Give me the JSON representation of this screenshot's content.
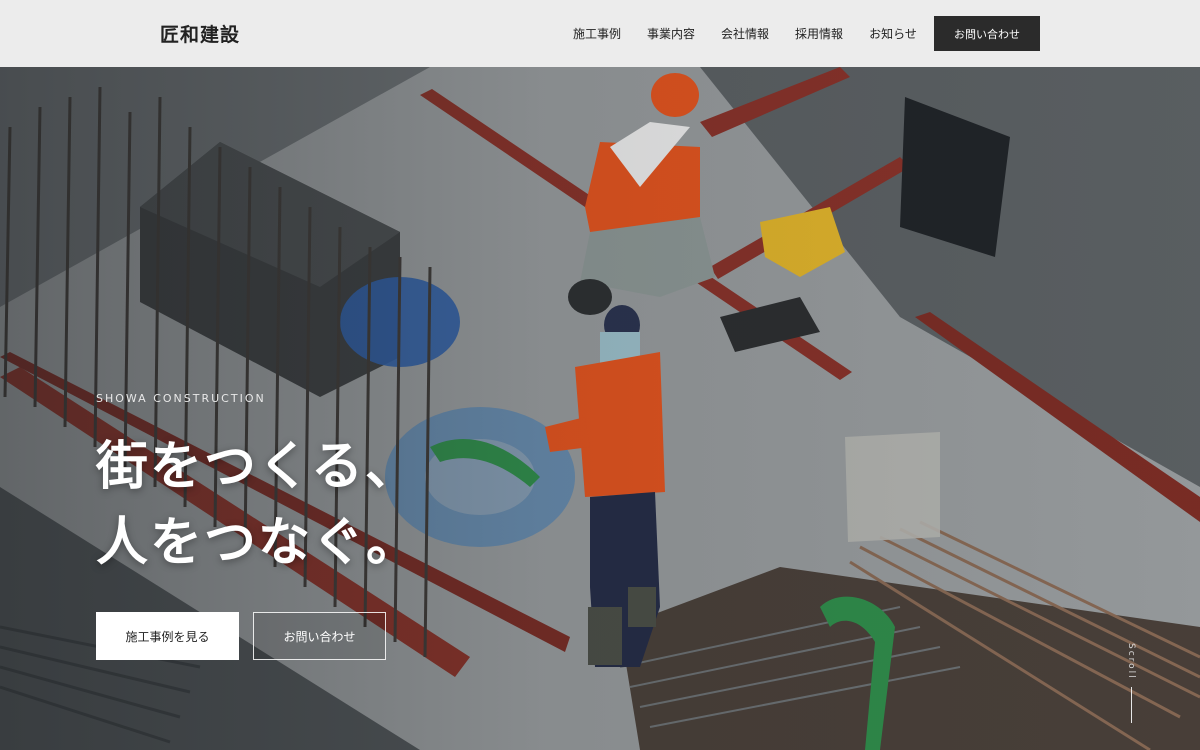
{
  "header": {
    "logo": "匠和建設",
    "nav": [
      "施工事例",
      "事業内容",
      "会社情報",
      "採用情報",
      "お知らせ"
    ],
    "contact_label": "お問い合わせ"
  },
  "hero": {
    "eyebrow": "SHOWA CONSTRUCTION",
    "title_line1": "街をつくる、",
    "title_line2": "人をつなぐ。",
    "primary_button": "施工事例を見る",
    "secondary_button": "お問い合わせ",
    "scroll_label": "Scroll"
  },
  "colors": {
    "header_bg": "#ececec",
    "contact_button_bg": "#2b2b2b",
    "safety_orange": "#e8541d",
    "steel_red": "#8a3128",
    "concrete": "#9ea2a3"
  },
  "icons": [
    "scroll-line-icon"
  ]
}
